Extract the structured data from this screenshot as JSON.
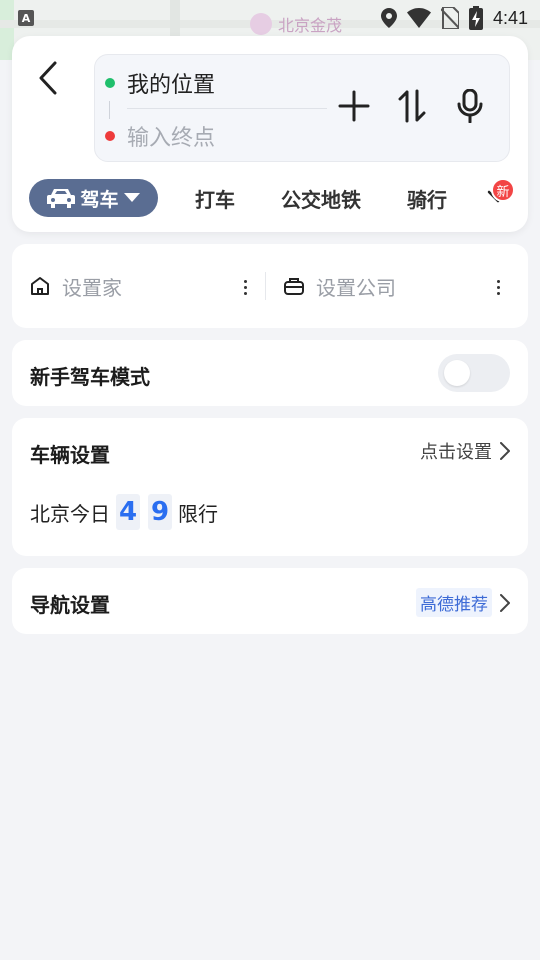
{
  "status_bar": {
    "time": "4:41",
    "left_icon": "a-notification-icon",
    "icons": [
      "location-icon",
      "wifi-icon",
      "no-sim-icon",
      "battery-charging-icon"
    ]
  },
  "map": {
    "poi_label": "北京金茂"
  },
  "route_input": {
    "start": "我的位置",
    "end_placeholder": "输入终点",
    "actions": [
      "add-waypoint-icon",
      "swap-icon",
      "microphone-icon"
    ]
  },
  "modes": {
    "active": "驾车",
    "tabs": [
      "打车",
      "公交地铁",
      "骑行"
    ],
    "new_badge": "新"
  },
  "shortcuts": {
    "home": "设置家",
    "company": "设置公司"
  },
  "novice_mode": {
    "label": "新手驾车模式",
    "enabled": false
  },
  "vehicle": {
    "title": "车辆设置",
    "link": "点击设置",
    "restriction_prefix": "北京今日",
    "restriction_numbers": [
      "4",
      "9"
    ],
    "restriction_suffix": "限行"
  },
  "navigation": {
    "title": "导航设置",
    "tag": "高德推荐"
  },
  "colors": {
    "accent_drive": "#5a6d92",
    "start_dot": "#1fbf6c",
    "end_dot": "#ee3b3b",
    "restriction_number": "#2a6ef0",
    "badge": "#f24545"
  }
}
